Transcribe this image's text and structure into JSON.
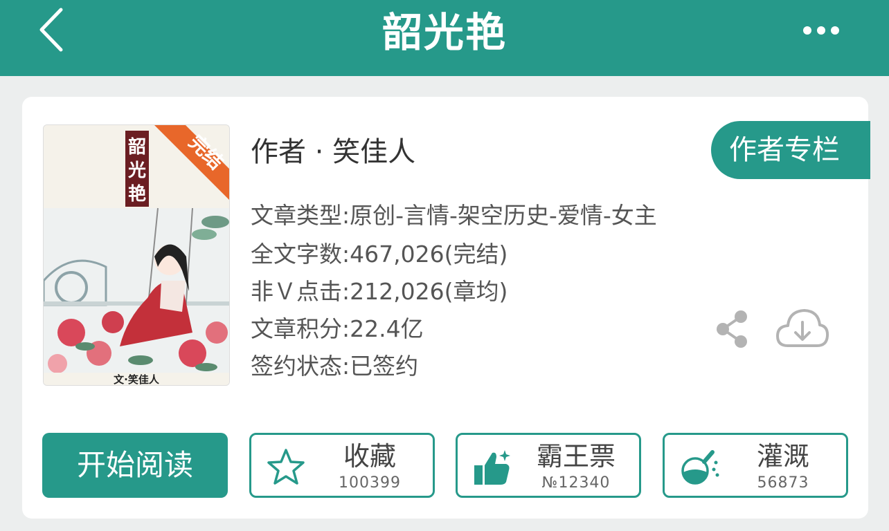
{
  "header": {
    "title": "韶光艳",
    "back_icon": "chevron-left-icon",
    "more_icon": "more-dots-icon"
  },
  "book": {
    "cover": {
      "title_vertical": "韶光艳",
      "ribbon": "完结",
      "byline": "文·笑佳人"
    },
    "author_line": "作者 · 笑佳人",
    "author_column_label": "作者专栏",
    "meta": {
      "genre": "文章类型:原创-言情-架空历史-爱情-女主",
      "word_count": "全文字数:467,026(完结)",
      "clicks": "非Ｖ点击:212,026(章均)",
      "score": "文章积分:22.4亿",
      "sign_status": "签约状态:已签约"
    },
    "share_icon": "share-icon",
    "download_icon": "cloud-download-icon"
  },
  "actions": {
    "start_reading": "开始阅读",
    "collect": {
      "label": "收藏",
      "count": "100399",
      "icon": "star-icon"
    },
    "vote": {
      "label": "霸王票",
      "count": "№12340",
      "icon": "thumbs-up-icon"
    },
    "water": {
      "label": "灌溉",
      "count": "56873",
      "icon": "flask-icon"
    }
  },
  "colors": {
    "accent": "#26998a",
    "background": "#eceeee",
    "card": "#ffffff",
    "ribbon": "#e8672a"
  }
}
